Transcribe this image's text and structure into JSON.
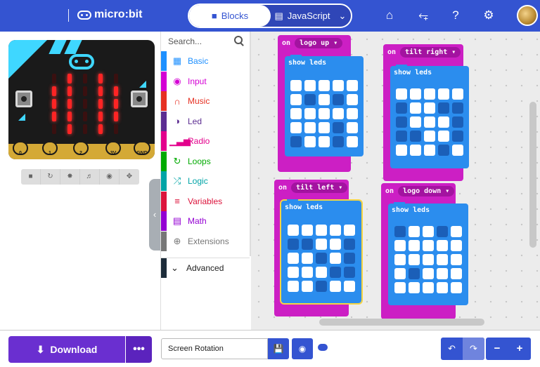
{
  "header": {
    "brand": "micro:bit",
    "tabs": [
      {
        "label": "Blocks",
        "icon": "puzzle-icon",
        "active": true
      },
      {
        "label": "JavaScript",
        "icon": "js-icon",
        "active": false
      }
    ],
    "icons": [
      "home-icon",
      "share-icon",
      "help-icon",
      "settings-icon"
    ],
    "accent": "#3454d1"
  },
  "simulator": {
    "pins": [
      "0",
      "1",
      "2",
      "3V",
      "GND"
    ],
    "button_a": "A",
    "button_b": "B",
    "display": [
      [
        0,
        1,
        0,
        1,
        0
      ],
      [
        1,
        1,
        0,
        1,
        1
      ],
      [
        1,
        1,
        0,
        1,
        1
      ],
      [
        1,
        1,
        0,
        1,
        1
      ],
      [
        0,
        1,
        0,
        1,
        0
      ]
    ],
    "controls": [
      "stop-icon",
      "restart-icon",
      "debug-icon",
      "mute-icon",
      "screenshot-icon",
      "fullscreen-icon"
    ]
  },
  "toolbox": {
    "search_placeholder": "Search...",
    "categories": [
      {
        "label": "Basic",
        "color": "#1e90ff",
        "icon": "grid-icon"
      },
      {
        "label": "Input",
        "color": "#d400d4",
        "icon": "target-icon"
      },
      {
        "label": "Music",
        "color": "#e63022",
        "icon": "headphones-icon"
      },
      {
        "label": "Led",
        "color": "#5c2d91",
        "icon": "toggle-icon"
      },
      {
        "label": "Radio",
        "color": "#e3008c",
        "icon": "signal-icon"
      },
      {
        "label": "Loops",
        "color": "#00aa00",
        "icon": "refresh-icon"
      },
      {
        "label": "Logic",
        "color": "#00a4a6",
        "icon": "shuffle-icon"
      },
      {
        "label": "Variables",
        "color": "#dc143c",
        "icon": "list-icon"
      },
      {
        "label": "Math",
        "color": "#9400d3",
        "icon": "calculator-icon"
      },
      {
        "label": "Extensions",
        "color": "#777777",
        "icon": "plus-circle-icon"
      }
    ],
    "advanced_label": "Advanced"
  },
  "workspace": {
    "blocks": [
      {
        "event": "on",
        "trigger": "logo up",
        "label": "show leds",
        "grid": [
          [
            0,
            0,
            0,
            0,
            0
          ],
          [
            0,
            1,
            0,
            1,
            0
          ],
          [
            0,
            0,
            0,
            0,
            0
          ],
          [
            0,
            0,
            0,
            1,
            0
          ],
          [
            1,
            0,
            0,
            1,
            0
          ]
        ]
      },
      {
        "event": "on",
        "trigger": "tilt right",
        "label": "show leds",
        "grid": [
          [
            0,
            0,
            0,
            0,
            0
          ],
          [
            1,
            0,
            0,
            1,
            1
          ],
          [
            1,
            0,
            0,
            0,
            1
          ],
          [
            1,
            1,
            0,
            0,
            1
          ],
          [
            0,
            0,
            0,
            1,
            0
          ]
        ]
      },
      {
        "event": "on",
        "trigger": "tilt left",
        "label": "show leds",
        "grid": [
          [
            0,
            0,
            0,
            0,
            0
          ],
          [
            1,
            1,
            0,
            0,
            1
          ],
          [
            0,
            0,
            1,
            0,
            1
          ],
          [
            0,
            0,
            0,
            1,
            1
          ],
          [
            0,
            0,
            1,
            0,
            0
          ]
        ]
      },
      {
        "event": "on",
        "trigger": "logo down",
        "label": "show leds",
        "grid": [
          [
            1,
            0,
            0,
            1,
            0
          ],
          [
            0,
            0,
            0,
            0,
            0
          ],
          [
            0,
            0,
            0,
            0,
            0
          ],
          [
            0,
            1,
            0,
            0,
            0
          ],
          [
            0,
            0,
            0,
            0,
            0
          ]
        ]
      }
    ]
  },
  "bottom": {
    "download_label": "Download",
    "more_label": "•••",
    "project_name": "Screen Rotation",
    "icons": [
      "save-icon",
      "github-icon",
      "cloud-icon",
      "undo-icon",
      "redo-icon",
      "zoom-out-icon",
      "zoom-in-icon"
    ]
  }
}
